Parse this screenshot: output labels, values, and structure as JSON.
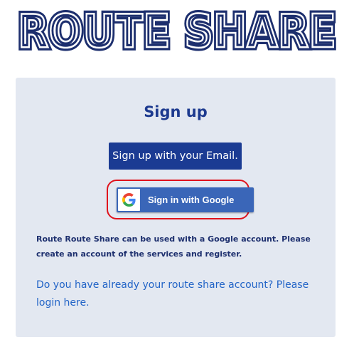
{
  "logo": {
    "text": "ROUTE SHARE",
    "color": "#1d2f6e"
  },
  "card": {
    "title": "Sign up",
    "email_button_label": "Sign up with your Email.",
    "google_button_label": "Sign in with Google",
    "info_text": "Route Route Share can be used with a Google account. Please create an account of the services and register.",
    "login_link_text": "Do you have already your route share account? Please login here."
  },
  "colors": {
    "primary": "#1b3b93",
    "google_blue": "#3a66b8",
    "highlight": "#e0121c",
    "card_bg": "#e3e8f1",
    "link": "#2264c7"
  },
  "icons": {
    "google": "google-g-icon"
  }
}
